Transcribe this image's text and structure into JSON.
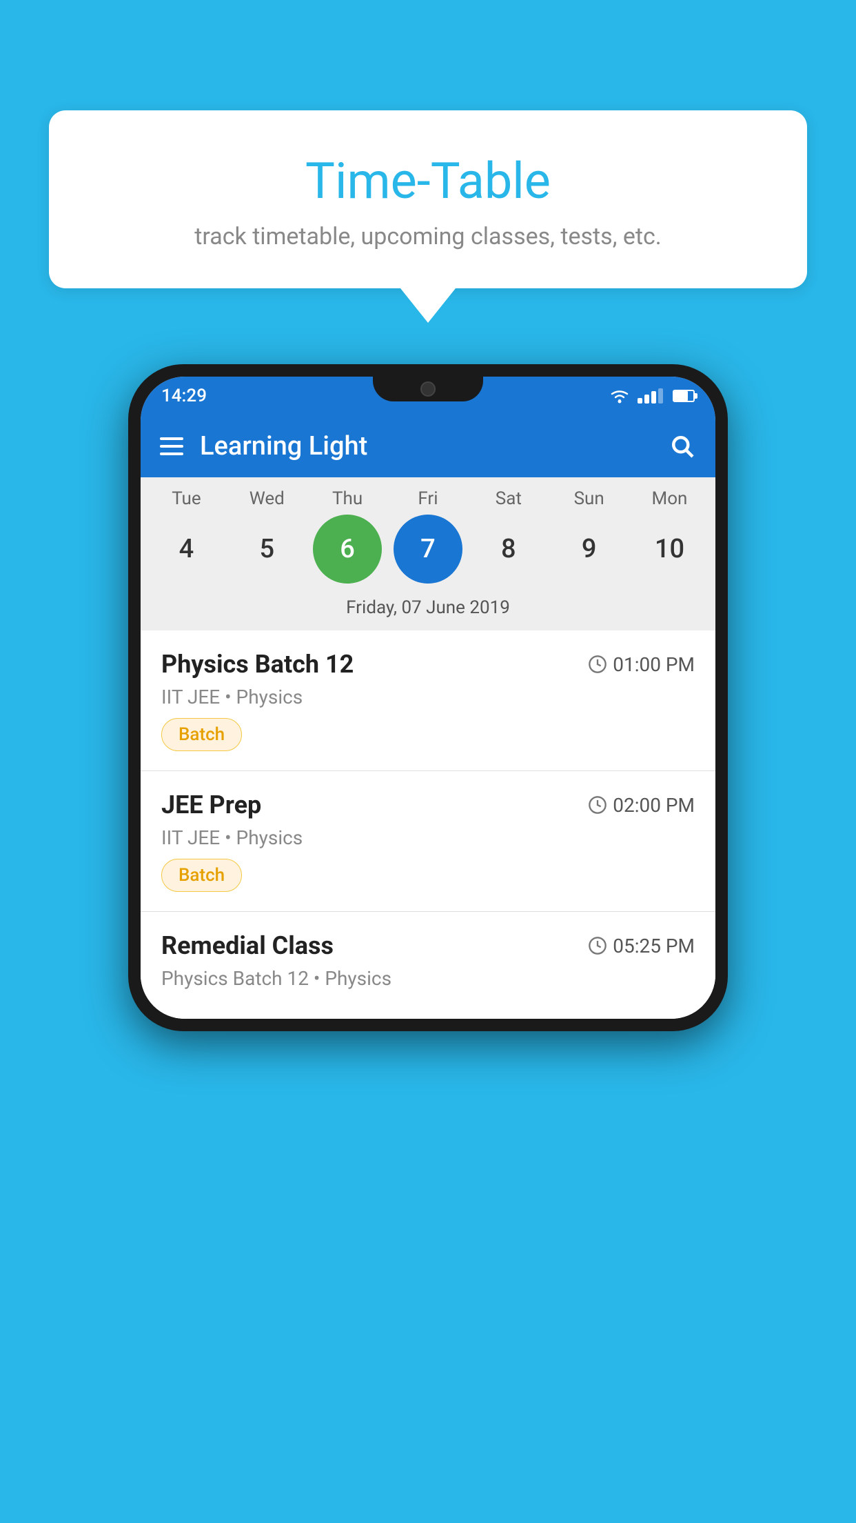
{
  "background_color": "#29B6E8",
  "bubble": {
    "title": "Time-Table",
    "subtitle": "track timetable, upcoming classes, tests, etc."
  },
  "phone": {
    "status_bar": {
      "time": "14:29"
    },
    "app_bar": {
      "title": "Learning Light"
    },
    "calendar": {
      "days": [
        {
          "label": "Tue",
          "number": "4",
          "state": "normal"
        },
        {
          "label": "Wed",
          "number": "5",
          "state": "normal"
        },
        {
          "label": "Thu",
          "number": "6",
          "state": "today"
        },
        {
          "label": "Fri",
          "number": "7",
          "state": "selected"
        },
        {
          "label": "Sat",
          "number": "8",
          "state": "normal"
        },
        {
          "label": "Sun",
          "number": "9",
          "state": "normal"
        },
        {
          "label": "Mon",
          "number": "10",
          "state": "normal"
        }
      ],
      "selected_date_label": "Friday, 07 June 2019"
    },
    "classes": [
      {
        "name": "Physics Batch 12",
        "time": "01:00 PM",
        "meta": "IIT JEE • Physics",
        "badge": "Batch"
      },
      {
        "name": "JEE Prep",
        "time": "02:00 PM",
        "meta": "IIT JEE • Physics",
        "badge": "Batch"
      },
      {
        "name": "Remedial Class",
        "time": "05:25 PM",
        "meta": "Physics Batch 12 • Physics",
        "badge": null
      }
    ]
  },
  "icons": {
    "hamburger": "☰",
    "search": "search",
    "clock": "clock"
  }
}
